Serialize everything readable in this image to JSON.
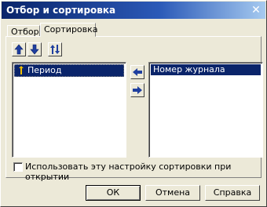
{
  "window": {
    "title": "Отбор и сортировка"
  },
  "tabs": [
    {
      "label": "Отбор",
      "active": false
    },
    {
      "label": "Сортировка",
      "active": true
    }
  ],
  "toolbar": {
    "buttons": [
      "arrow-up-icon",
      "arrow-down-icon",
      "sort-order-icon"
    ]
  },
  "left_list": {
    "items": [
      {
        "label": "Период",
        "selected": true,
        "icon": "sort-direction-icon"
      }
    ]
  },
  "right_list": {
    "items": [
      {
        "label": "Номер журнала",
        "selected": true
      }
    ]
  },
  "move_buttons": [
    "arrow-left-icon",
    "arrow-right-icon"
  ],
  "checkbox": {
    "label": "Использовать эту настройку сортировки при открытии",
    "checked": false
  },
  "buttons": {
    "ok": "ОК",
    "cancel": "Отмена",
    "help": "Справка"
  },
  "colors": {
    "accent": "#0a246a",
    "face": "#ece9d8"
  }
}
